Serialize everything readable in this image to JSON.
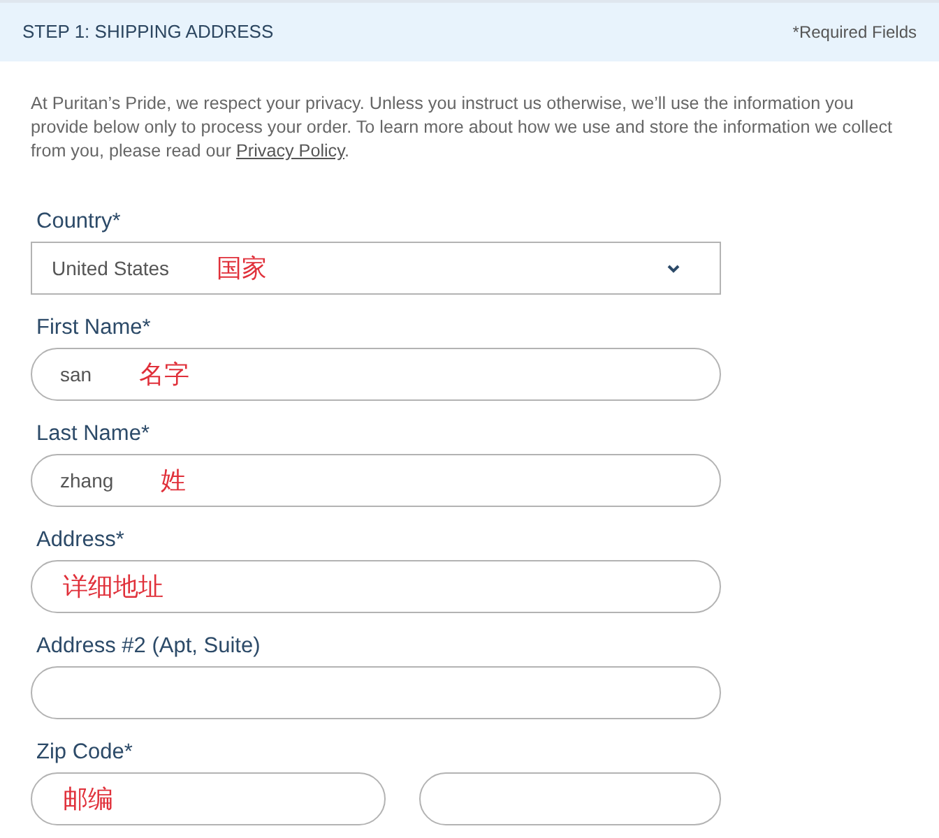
{
  "header": {
    "title": "STEP 1:  SHIPPING ADDRESS",
    "note": "*Required Fields"
  },
  "privacy_notice": {
    "text": "At Puritan’s Pride, we respect your privacy. Unless you instruct us otherwise, we’ll use the information you provide below only to process your order. To learn more about how we use and store the information we collect from you, please read our ",
    "link": "Privacy Policy",
    "end": "."
  },
  "fields": [
    {
      "label": "Country*",
      "kind": "select",
      "value": "United States",
      "annotation": "国家"
    },
    {
      "label": "First Name*",
      "kind": "text",
      "value": "san",
      "annotation": "名字"
    },
    {
      "label": "Last Name*",
      "kind": "text",
      "value": "zhang",
      "annotation": "姓"
    },
    {
      "label": "Address*",
      "kind": "text",
      "annotation": "详细地址"
    },
    {
      "label": "Address #2 (Apt, Suite)",
      "kind": "text"
    },
    {
      "label": "Zip Code*",
      "kind": "text",
      "annotation": "邮编",
      "split": true
    }
  ]
}
